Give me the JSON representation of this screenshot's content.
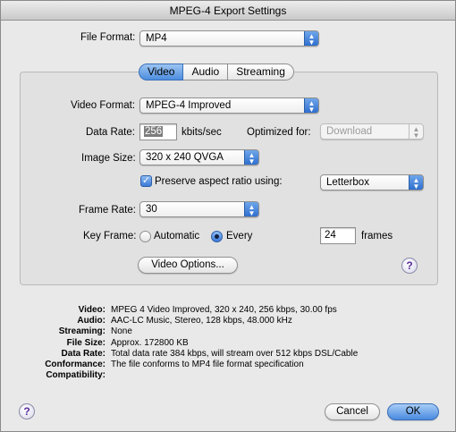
{
  "window": {
    "title": "MPEG-4 Export Settings"
  },
  "file_format": {
    "label": "File Format:",
    "value": "MP4"
  },
  "tabs": [
    {
      "label": "Video",
      "selected": true
    },
    {
      "label": "Audio",
      "selected": false
    },
    {
      "label": "Streaming",
      "selected": false
    }
  ],
  "video": {
    "format_label": "Video Format:",
    "format_value": "MPEG-4 Improved",
    "data_rate_label": "Data Rate:",
    "data_rate_value": "256",
    "data_rate_unit": "kbits/sec",
    "optimized_label": "Optimized for:",
    "optimized_value": "Download",
    "image_size_label": "Image Size:",
    "image_size_value": "320 x 240 QVGA",
    "preserve_label": "Preserve aspect ratio using:",
    "preserve_checked": true,
    "preserve_value": "Letterbox",
    "frame_rate_label": "Frame Rate:",
    "frame_rate_value": "30",
    "key_frame_label": "Key Frame:",
    "key_frame_automatic": "Automatic",
    "key_frame_every": "Every",
    "key_frame_selected": "Every",
    "key_frame_count": "24",
    "key_frame_unit": "frames",
    "options_button": "Video Options..."
  },
  "help_glyph": "?",
  "summary": [
    {
      "key": "Video:",
      "value": "MPEG 4 Video Improved, 320 x 240, 256 kbps, 30.00 fps"
    },
    {
      "key": "Audio:",
      "value": "AAC-LC Music, Stereo, 128 kbps, 48.000 kHz"
    },
    {
      "key": "Streaming:",
      "value": "None"
    },
    {
      "key": "File Size:",
      "value": "Approx. 172800 KB"
    },
    {
      "key": "Data Rate:",
      "value": "Total data rate 384 kbps, will stream over 512 kbps DSL/Cable"
    },
    {
      "key": "Conformance:",
      "value": "The file conforms to MP4 file format specification"
    },
    {
      "key": "Compatibility:",
      "value": ""
    }
  ],
  "buttons": {
    "cancel": "Cancel",
    "ok": "OK"
  },
  "icons": {
    "popup_arrows": "▲▼",
    "checkmark": "✓"
  }
}
